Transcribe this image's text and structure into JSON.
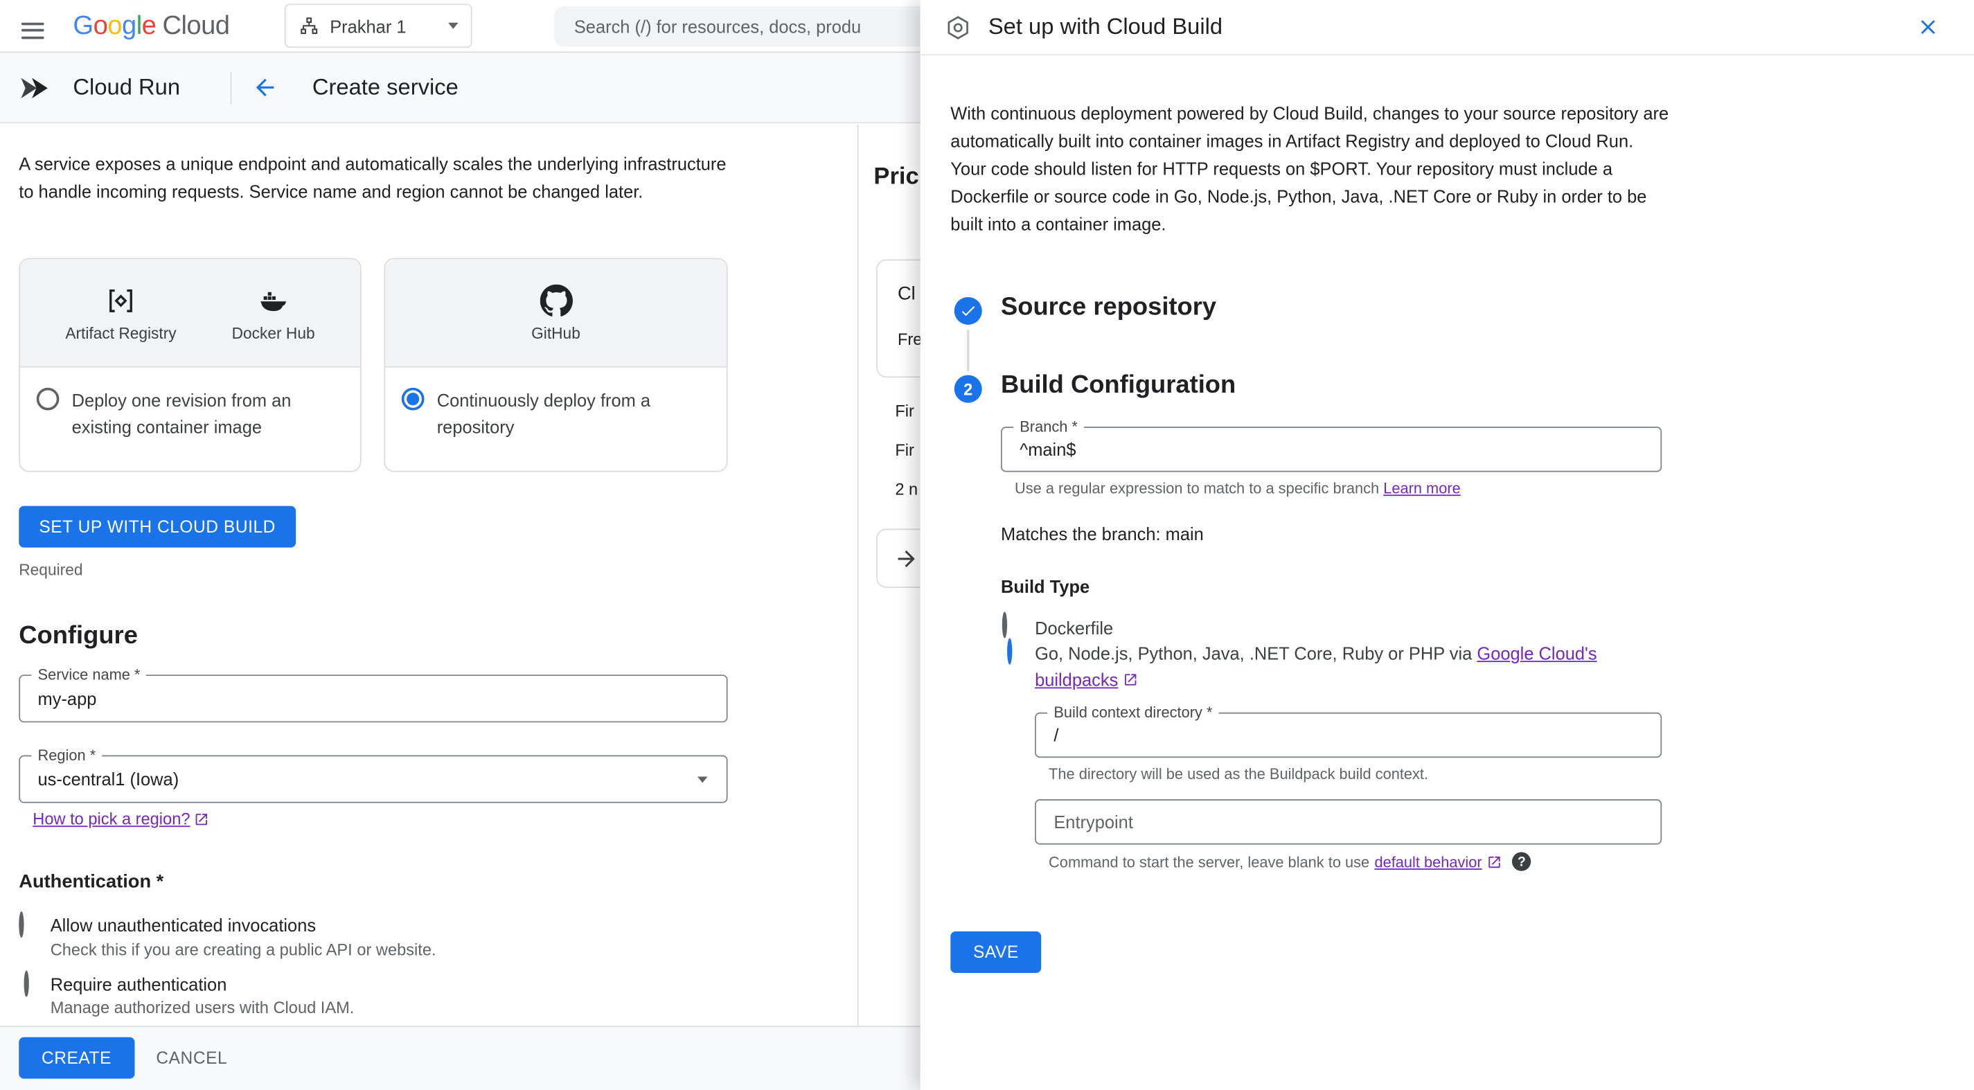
{
  "topbar": {
    "logo_letters": [
      {
        "ch": "G",
        "color": "#4285F4"
      },
      {
        "ch": "o",
        "color": "#EA4335"
      },
      {
        "ch": "o",
        "color": "#FBBC04"
      },
      {
        "ch": "g",
        "color": "#4285F4"
      },
      {
        "ch": "l",
        "color": "#34A853"
      },
      {
        "ch": "e",
        "color": "#EA4335"
      }
    ],
    "logo_cloud": "Cloud",
    "project_name": "Prakhar 1",
    "search_placeholder": "Search (/) for resources, docs, produ"
  },
  "subheader": {
    "product": "Cloud Run",
    "page_title": "Create service"
  },
  "main": {
    "description": "A service exposes a unique endpoint and automatically scales the underlying infrastructure to handle incoming requests. Service name and region cannot be changed later.",
    "card_existing": {
      "icon_labels": {
        "artifact_registry": "Artifact Registry",
        "docker_hub": "Docker Hub"
      },
      "radio_label": "Deploy one revision from an existing container image",
      "selected": false
    },
    "card_repo": {
      "icon_labels": {
        "github": "GitHub"
      },
      "radio_label": "Continuously deploy from a repository",
      "selected": true
    },
    "setup_button": "SET UP WITH CLOUD BUILD",
    "required_note": "Required",
    "configure_heading": "Configure",
    "service_name": {
      "label": "Service name *",
      "value": "my-app"
    },
    "region": {
      "label": "Region *",
      "value": "us-central1 (Iowa)"
    },
    "region_link": "How to pick a region?",
    "auth_heading": "Authentication *",
    "auth_options": [
      {
        "label": "Allow unauthenticated invocations",
        "description": "Check this if you are creating a public API or website.",
        "selected": false
      },
      {
        "label": "Require authentication",
        "description": "Manage authorized users with Cloud IAM.",
        "selected": false
      }
    ],
    "create_button": "CREATE",
    "cancel_button": "CANCEL"
  },
  "pricing_fragments": {
    "heading": "Pric",
    "card_title": "Cl",
    "card_sub": "Fre",
    "row1": "Fir",
    "row2": "Fir",
    "row3": "2 n"
  },
  "panel": {
    "title": "Set up with Cloud Build",
    "intro_p1": "With continuous deployment powered by Cloud Build, changes to your source repository are automatically built into container images in Artifact Registry and deployed to Cloud Run.",
    "intro_p2": "Your code should listen for HTTP requests on $PORT. Your repository must include a Dockerfile or source code in Go, Node.js, Python, Java, .NET Core or Ruby in order to be built into a container image.",
    "step1_title": "Source repository",
    "step2_number": "2",
    "step2_title": "Build Configuration",
    "branch_label": "Branch *",
    "branch_value": "^main$",
    "branch_helper": "Use a regular expression to match to a specific branch ",
    "branch_helper_link": "Learn more",
    "matches_text": "Matches the branch: main",
    "build_type_label": "Build Type",
    "build_type_option1": "Dockerfile",
    "build_type_option2_prefix": "Go, Node.js, Python, Java, .NET Core, Ruby or PHP via ",
    "build_type_option2_link": "Google Cloud's buildpacks",
    "context_label": "Build context directory *",
    "context_value": "/",
    "context_helper": "The directory will be used as the Buildpack build context.",
    "entrypoint_label": "Entrypoint",
    "entrypoint_helper_prefix": "Command to start the server, leave blank to use ",
    "entrypoint_helper_link": "default behavior",
    "save_button": "SAVE"
  },
  "colors": {
    "primary": "#1a73e8",
    "link": "#7627bb",
    "text": "#202124",
    "secondary_text": "#5f6368"
  }
}
